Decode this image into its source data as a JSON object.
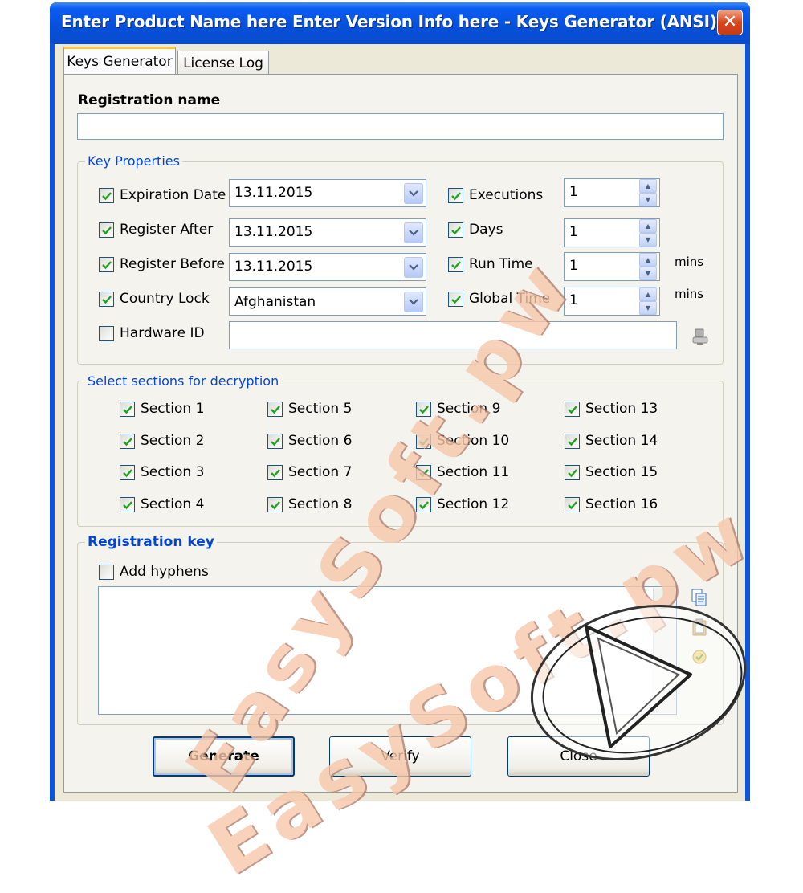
{
  "window": {
    "title": "Enter Product Name here Enter Version Info here - Keys Generator (ANSI)"
  },
  "tabs": [
    {
      "label": "Keys Generator",
      "active": true
    },
    {
      "label": "License Log",
      "active": false
    }
  ],
  "registration_name": {
    "label": "Registration name",
    "value": ""
  },
  "key_properties": {
    "title": "Key Properties",
    "expiration_date": {
      "label": "Expiration Date",
      "checked": true,
      "value": "13.11.2015"
    },
    "register_after": {
      "label": "Register After",
      "checked": true,
      "value": "13.11.2015"
    },
    "register_before": {
      "label": "Register Before",
      "checked": true,
      "value": "13.11.2015"
    },
    "country_lock": {
      "label": "Country Lock",
      "checked": true,
      "value": "Afghanistan"
    },
    "hardware_id": {
      "label": "Hardware ID",
      "checked": false,
      "value": ""
    },
    "executions": {
      "label": "Executions",
      "checked": true,
      "value": "1"
    },
    "days": {
      "label": "Days",
      "checked": true,
      "value": "1"
    },
    "run_time": {
      "label": "Run Time",
      "checked": true,
      "value": "1",
      "unit": "mins"
    },
    "global_time": {
      "label": "Global Time",
      "checked": true,
      "value": "1",
      "unit": "mins"
    }
  },
  "sections": {
    "title": "Select sections for decryption",
    "items": [
      "Section 1",
      "Section 2",
      "Section 3",
      "Section 4",
      "Section 5",
      "Section 6",
      "Section 7",
      "Section 8",
      "Section 9",
      "Section 10",
      "Section 11",
      "Section 12",
      "Section 13",
      "Section 14",
      "Section 15",
      "Section 16"
    ]
  },
  "registration_key": {
    "title": "Registration key",
    "add_hyphens": {
      "label": "Add hyphens",
      "checked": false
    },
    "value": ""
  },
  "buttons": {
    "generate": "Generate",
    "verify": "Verify",
    "close": "Close"
  },
  "watermark": {
    "text": "EasySoft.pw"
  },
  "colors": {
    "titlebar": "#0650d8",
    "group_title": "#0046d5",
    "panel": "#f4f3ee",
    "checkmark": "#21a121"
  }
}
